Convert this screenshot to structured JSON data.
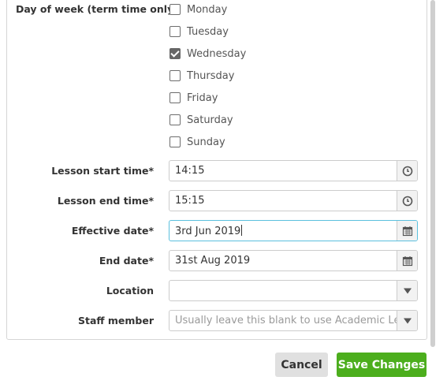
{
  "day_of_week": {
    "label": "Day of week (term time only)",
    "options": [
      {
        "label": "Monday",
        "checked": false
      },
      {
        "label": "Tuesday",
        "checked": false
      },
      {
        "label": "Wednesday",
        "checked": true
      },
      {
        "label": "Thursday",
        "checked": false
      },
      {
        "label": "Friday",
        "checked": false
      },
      {
        "label": "Saturday",
        "checked": false
      },
      {
        "label": "Sunday",
        "checked": false
      }
    ]
  },
  "fields": {
    "lesson_start": {
      "label": "Lesson start time*",
      "value": "14:15",
      "icon": "clock-icon"
    },
    "lesson_end": {
      "label": "Lesson end time*",
      "value": "15:15",
      "icon": "clock-icon"
    },
    "effective_date": {
      "label": "Effective date*",
      "value": "3rd Jun 2019",
      "icon": "calendar-icon"
    },
    "end_date": {
      "label": "End date*",
      "value": "31st Aug 2019",
      "icon": "calendar-icon"
    },
    "location": {
      "label": "Location",
      "value": "",
      "icon": "dropdown-arrow-icon"
    },
    "staff_member": {
      "label": "Staff member",
      "placeholder": "Usually leave this blank to use Academic Leads",
      "icon": "dropdown-arrow-icon"
    }
  },
  "buttons": {
    "cancel": "Cancel",
    "save": "Save Changes"
  },
  "colors": {
    "save_button": "#4cae1d",
    "focus_border": "#5bc0de",
    "checked_box": "#666666"
  }
}
